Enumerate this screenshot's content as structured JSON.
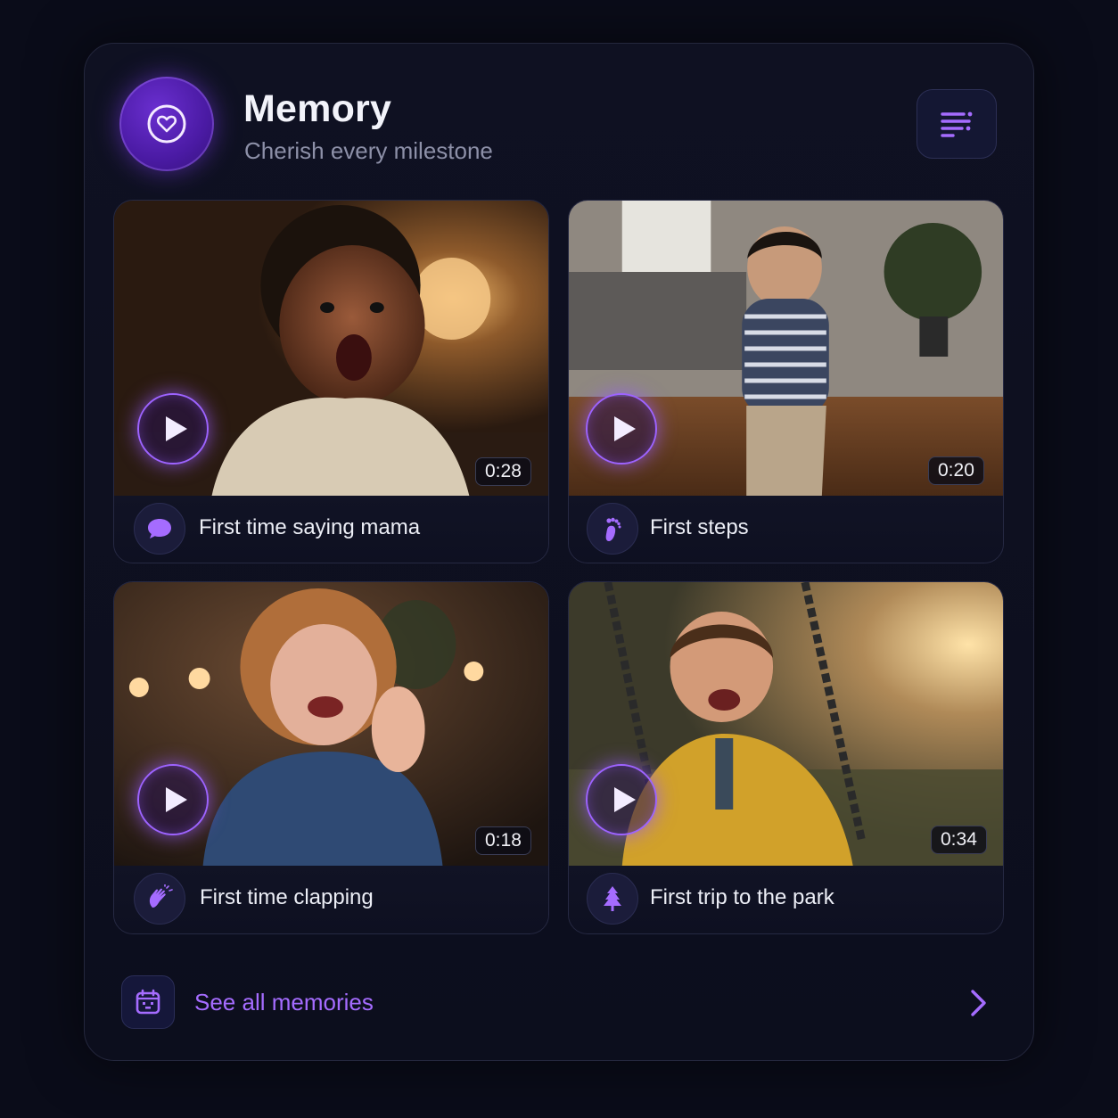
{
  "header": {
    "title": "Memory",
    "subtitle": "Cherish every milestone",
    "brand_icon": "heart-icon",
    "filter_icon": "sort-filter-icon"
  },
  "memories": [
    {
      "caption": "First time saying mama",
      "duration": "0:28",
      "icon": "speech-bubble-icon"
    },
    {
      "caption": "First steps",
      "duration": "0:20",
      "icon": "footprint-icon"
    },
    {
      "caption": "First time clapping",
      "duration": "0:18",
      "icon": "clapping-hands-icon"
    },
    {
      "caption": "First trip to the park",
      "duration": "0:34",
      "icon": "tree-icon"
    }
  ],
  "footer": {
    "see_all_label": "See all memories",
    "see_all_icon": "calendar-icon",
    "chevron_icon": "chevron-right-icon"
  },
  "colors": {
    "background": "#0a0c19",
    "accent": "#9d63ff",
    "accent_deep": "#4a1aa3",
    "text_primary": "#f2f3fa",
    "text_secondary": "#8d90a8"
  }
}
